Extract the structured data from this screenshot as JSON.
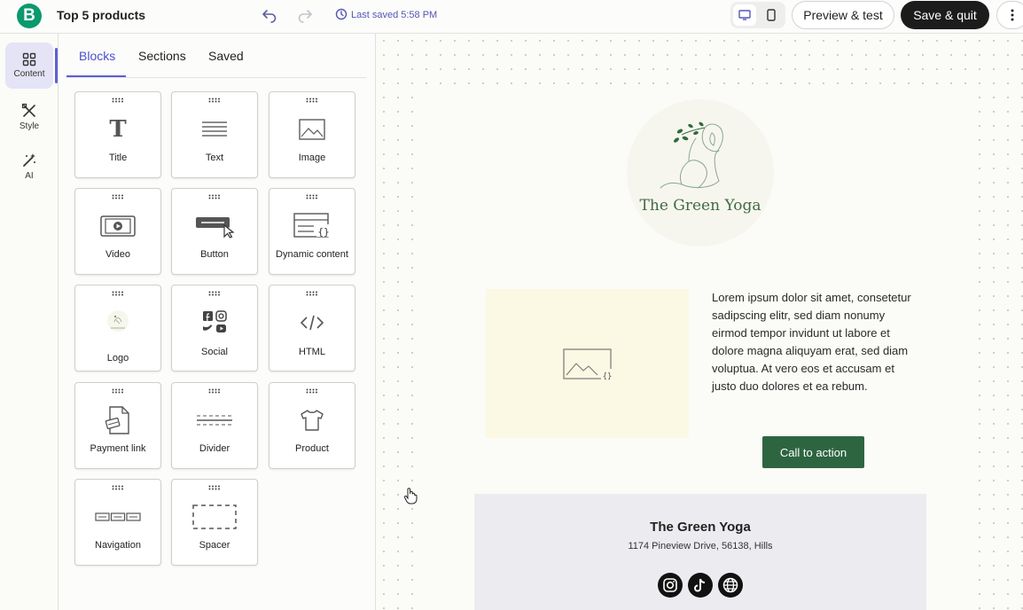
{
  "header": {
    "logo_letter": "B",
    "title": "Top 5 products",
    "saved_status": "Last saved 5:58 PM",
    "preview_label": "Preview & test",
    "save_label": "Save & quit",
    "accent_color": "#5c5fd6",
    "brand_color": "#0b996e"
  },
  "rail": {
    "items": [
      {
        "label": "Content",
        "icon": "grid-icon",
        "active": true
      },
      {
        "label": "Style",
        "icon": "brush-icon"
      },
      {
        "label": "AI",
        "icon": "magic-wand-icon"
      }
    ]
  },
  "panel": {
    "tabs": [
      "Blocks",
      "Sections",
      "Saved"
    ],
    "active_tab": "Blocks",
    "blocks": [
      {
        "label": "Title",
        "icon": "title-icon"
      },
      {
        "label": "Text",
        "icon": "text-icon"
      },
      {
        "label": "Image",
        "icon": "image-icon"
      },
      {
        "label": "Video",
        "icon": "video-icon"
      },
      {
        "label": "Button",
        "icon": "button-icon"
      },
      {
        "label": "Dynamic content",
        "icon": "dynamic-content-icon"
      },
      {
        "label": "Logo",
        "icon": "logo-icon"
      },
      {
        "label": "Social",
        "icon": "social-icon"
      },
      {
        "label": "HTML",
        "icon": "code-icon"
      },
      {
        "label": "Payment link",
        "icon": "payment-link-icon"
      },
      {
        "label": "Divider",
        "icon": "divider-icon"
      },
      {
        "label": "Product",
        "icon": "tshirt-icon"
      },
      {
        "label": "Navigation",
        "icon": "navigation-icon"
      },
      {
        "label": "Spacer",
        "icon": "spacer-icon"
      }
    ]
  },
  "email": {
    "brand_name": "The Green Yoga",
    "body_text": "Lorem ipsum dolor sit amet, consetetur sadipscing elitr, sed diam nonumy eirmod tempor invidunt ut labore et dolore magna aliquyam erat, sed diam voluptua. At vero eos et accusam et justo duo dolores et ea rebum.",
    "cta_label": "Call to action",
    "cta_color": "#2d6541",
    "footer_title": "The Green Yoga",
    "footer_address": "1174 Pineview Drive, 56138, Hills",
    "social_icons": [
      "instagram-icon",
      "tiktok-icon",
      "globe-icon"
    ]
  }
}
